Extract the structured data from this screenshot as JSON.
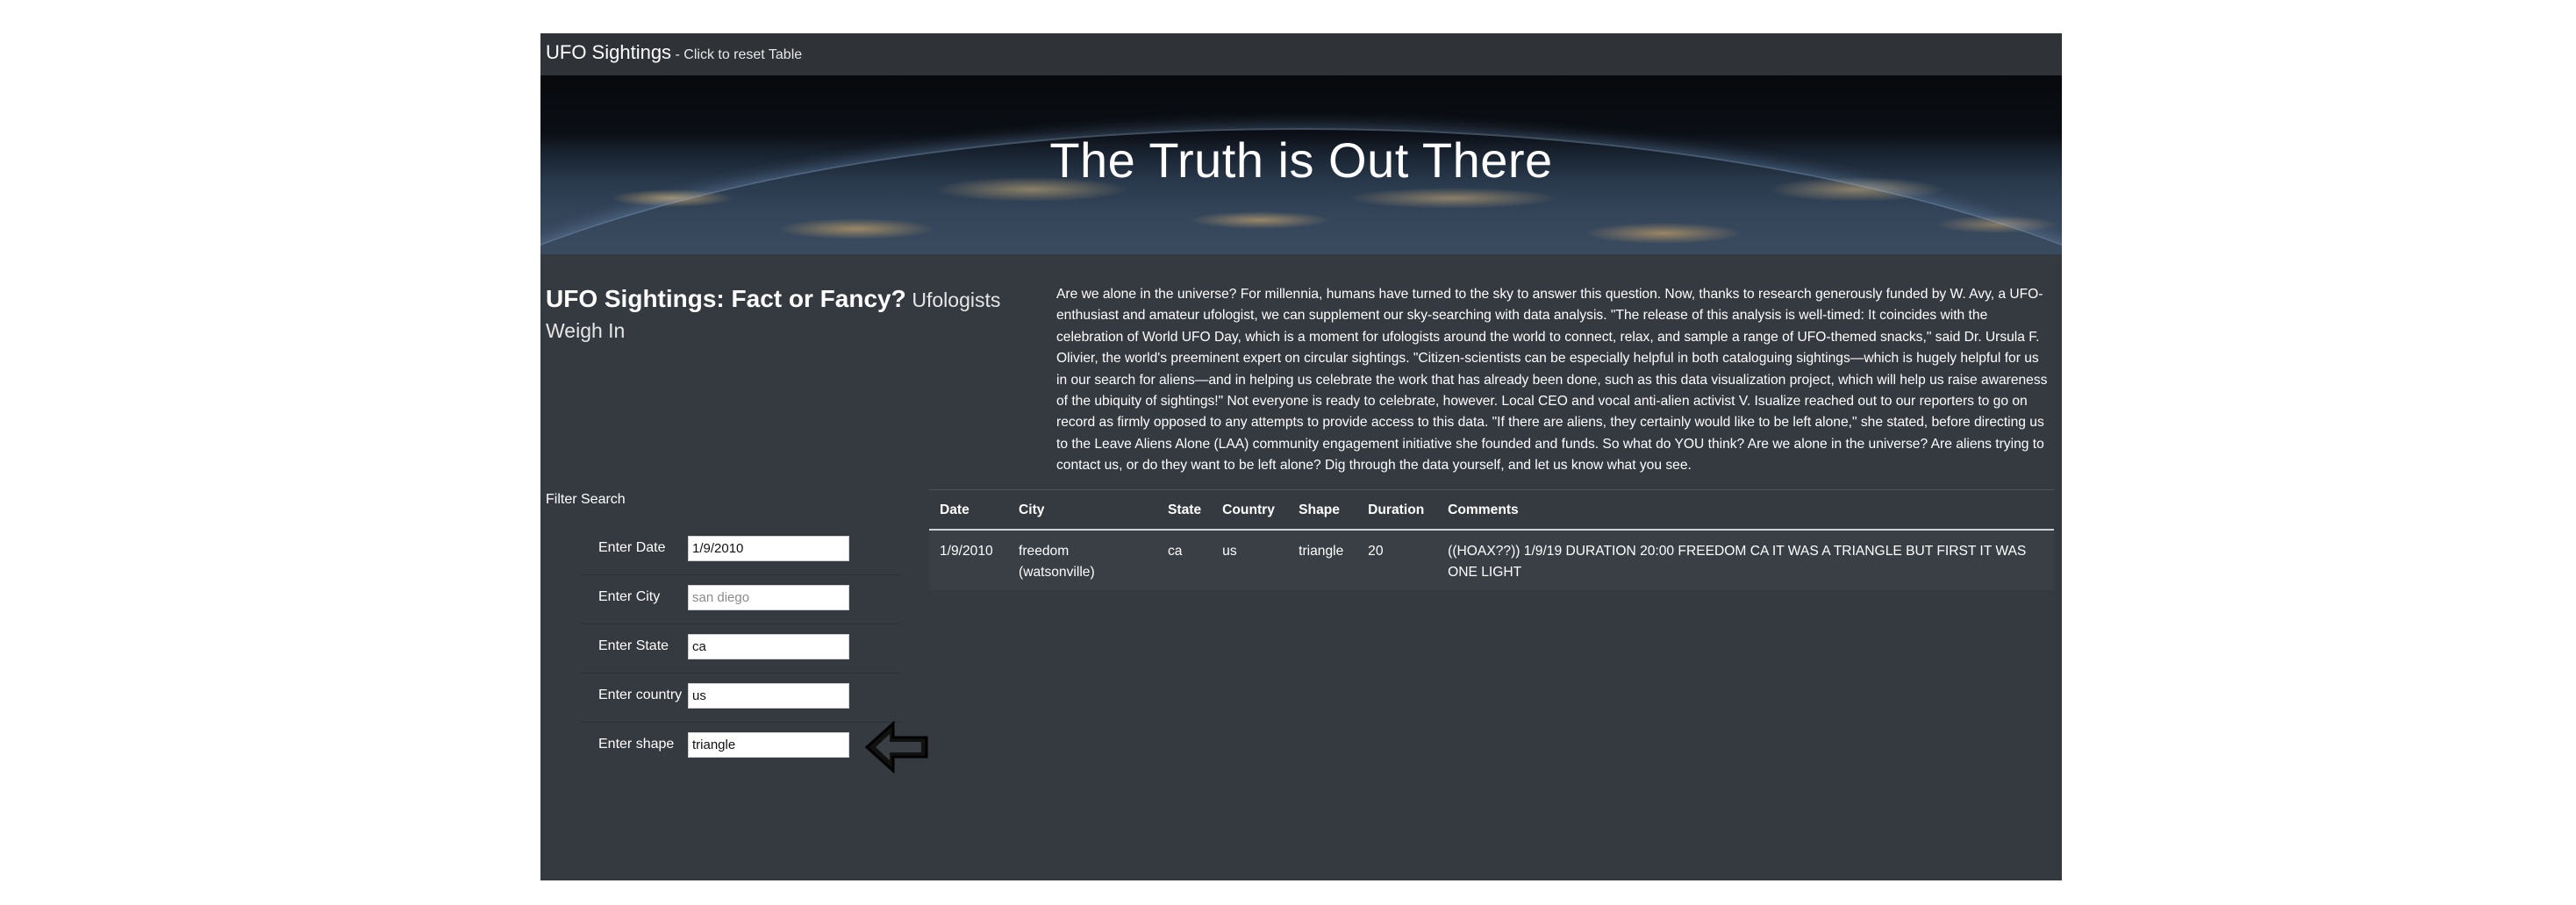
{
  "navbar": {
    "brand": "UFO Sightings",
    "brand_sub": " - Click to reset Table"
  },
  "hero": {
    "title": "The Truth is Out There"
  },
  "article": {
    "heading_main": "UFO Sightings: Fact or Fancy?",
    "heading_small": "Ufologists Weigh In",
    "body": "Are we alone in the universe? For millennia, humans have turned to the sky to answer this question. Now, thanks to research generously funded by W. Avy, a UFO-enthusiast and amateur ufologist, we can supplement our sky-searching with data analysis. \"The release of this analysis is well-timed: It coincides with the celebration of World UFO Day, which is a moment for ufologists around the world to connect, relax, and sample a range of UFO-themed snacks,\" said Dr. Ursula F. Olivier, the world's preeminent expert on circular sightings. \"Citizen-scientists can be especially helpful in both cataloguing sightings—which is hugely helpful for us in our search for aliens—and in helping us celebrate the work that has already been done, such as this data visualization project, which will help us raise awareness of the ubiquity of sightings!\" Not everyone is ready to celebrate, however. Local CEO and vocal anti-alien activist V. Isualize reached out to our reporters to go on record as firmly opposed to any attempts to provide access to this data. \"If there are aliens, they certainly would like to be left alone,\" she stated, before directing us to the Leave Aliens Alone (LAA) community engagement initiative she founded and funds. So what do YOU think? Are we alone in the universe? Are aliens trying to contact us, or do they want to be left alone? Dig through the data yourself, and let us know what you see."
  },
  "filters": {
    "title": "Filter Search",
    "items": [
      {
        "label": "Enter Date",
        "value": "1/9/2010",
        "placeholder": ""
      },
      {
        "label": "Enter City",
        "value": "",
        "placeholder": "san diego"
      },
      {
        "label": "Enter State",
        "value": "ca",
        "placeholder": ""
      },
      {
        "label": "Enter country",
        "value": "us",
        "placeholder": ""
      },
      {
        "label": "Enter shape",
        "value": "triangle",
        "placeholder": ""
      }
    ]
  },
  "table": {
    "headers": [
      "Date",
      "City",
      "State",
      "Country",
      "Shape",
      "Duration",
      "Comments"
    ],
    "rows": [
      [
        "1/9/2010",
        "freedom (watsonville)",
        "ca",
        "us",
        "triangle",
        "20",
        "((HOAX??)) 1/9/19 DURATION 20:00 FREEDOM CA IT WAS A TRIANGLE BUT FIRST IT WAS ONE LIGHT"
      ]
    ]
  },
  "icons": {
    "pointer": "left-arrow-icon"
  },
  "colors": {
    "page_bg": "#353940",
    "navbar_bg": "#2f3338",
    "input_bg": "#ffffff"
  }
}
